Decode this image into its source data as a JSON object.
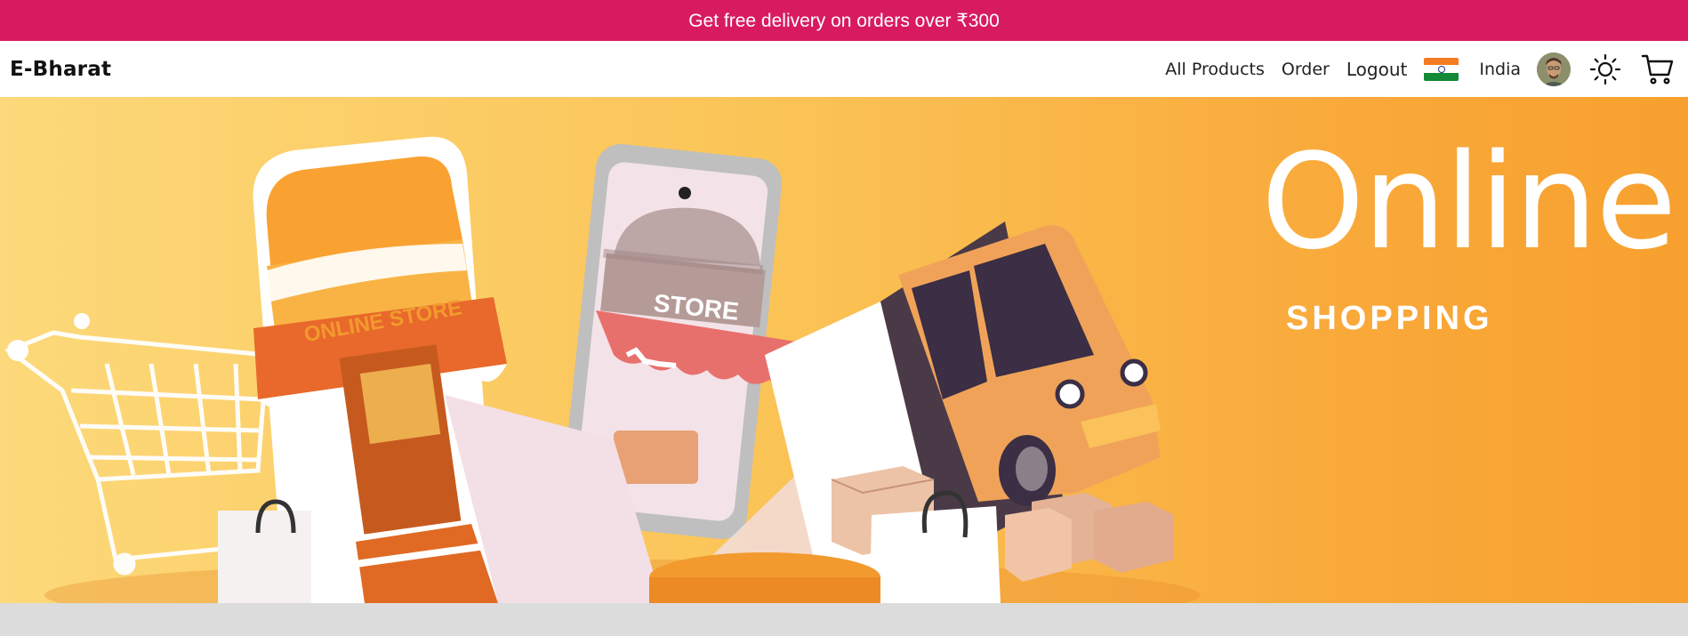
{
  "promo": {
    "text": "Get free delivery on orders over ₹300"
  },
  "nav": {
    "brand": "E-Bharat",
    "links": {
      "all_products": "All Products",
      "order": "Order",
      "logout": "Logout"
    },
    "country": "India",
    "icons": {
      "flag": "india-flag-icon",
      "avatar": "user-avatar",
      "theme": "sun-icon",
      "cart": "cart-icon"
    }
  },
  "hero": {
    "title": "Online.",
    "subtitle": "SHOPPING",
    "art_labels": {
      "shop_sign": "ONLINE STORE",
      "phone_sign": "STORE"
    }
  },
  "colors": {
    "promo_bg": "#d81b60",
    "hero_bg_start": "#fcd97a",
    "hero_bg_end": "#f7a02f",
    "text_dark": "#111111"
  }
}
